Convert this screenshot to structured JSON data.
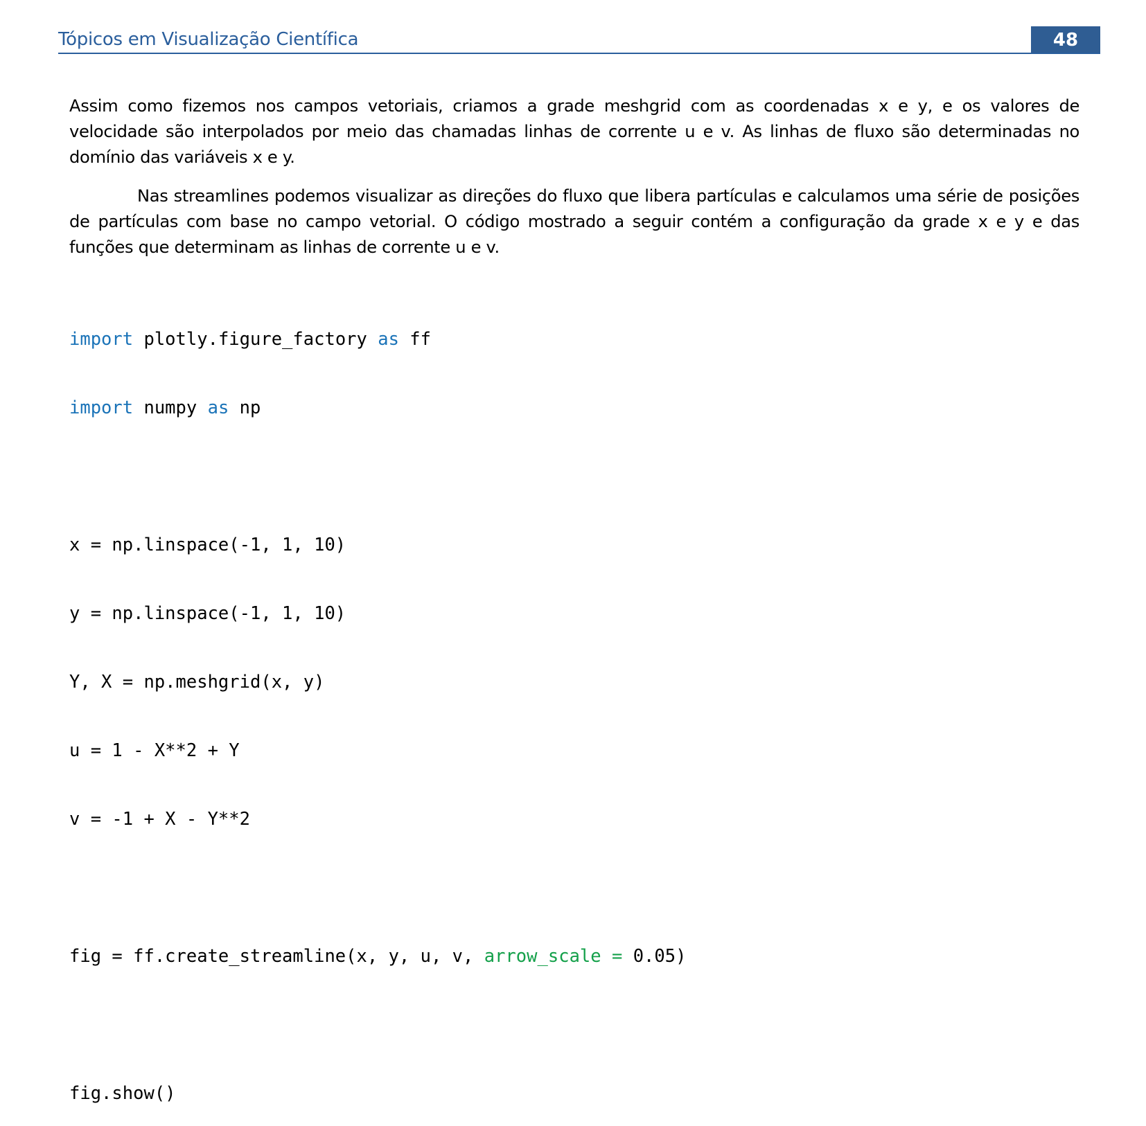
{
  "header": {
    "title": "Tópicos em Visualização Científica",
    "page_number": "48",
    "accent_color": "#2f5d93"
  },
  "paragraphs": [
    "Assim como fizemos nos campos vetoriais, criamos a grade meshgrid com as coordenadas x e y, e os valores de velocidade são interpolados por meio das chamadas linhas de corrente u e v. As linhas de fluxo são determinadas no domínio das variáveis x e y.",
    "Nas streamlines podemos visualizar as direções do fluxo que libera partículas e calculamos uma série de posições de partículas com base no campo vetorial. O código mostrado a seguir contém a configuração da grade x e y e das funções que determinam as linhas de corrente u e v."
  ],
  "code": {
    "line1": {
      "kw1": "import",
      "mid": " plotly.figure_factory ",
      "kw2": "as",
      "end": " ff"
    },
    "line2": {
      "kw1": "import",
      "mid": " numpy ",
      "kw2": "as",
      "end": " np"
    },
    "line4": "x = np.linspace(-1, 1, 10)",
    "line5": "y = np.linspace(-1, 1, 10)",
    "line6": "Y, X = np.meshgrid(x, y)",
    "line7": "u = 1 - X**2 + Y",
    "line8": "v = -1 + X - Y**2",
    "line10": {
      "start": "fig = ff.create_streamline(x, y, u, v, ",
      "arg": "arrow_scale =",
      "end": " 0.05)"
    },
    "line12": "fig.show()",
    "keyword_color": "#1a73b8",
    "argument_color": "#14a04a"
  }
}
